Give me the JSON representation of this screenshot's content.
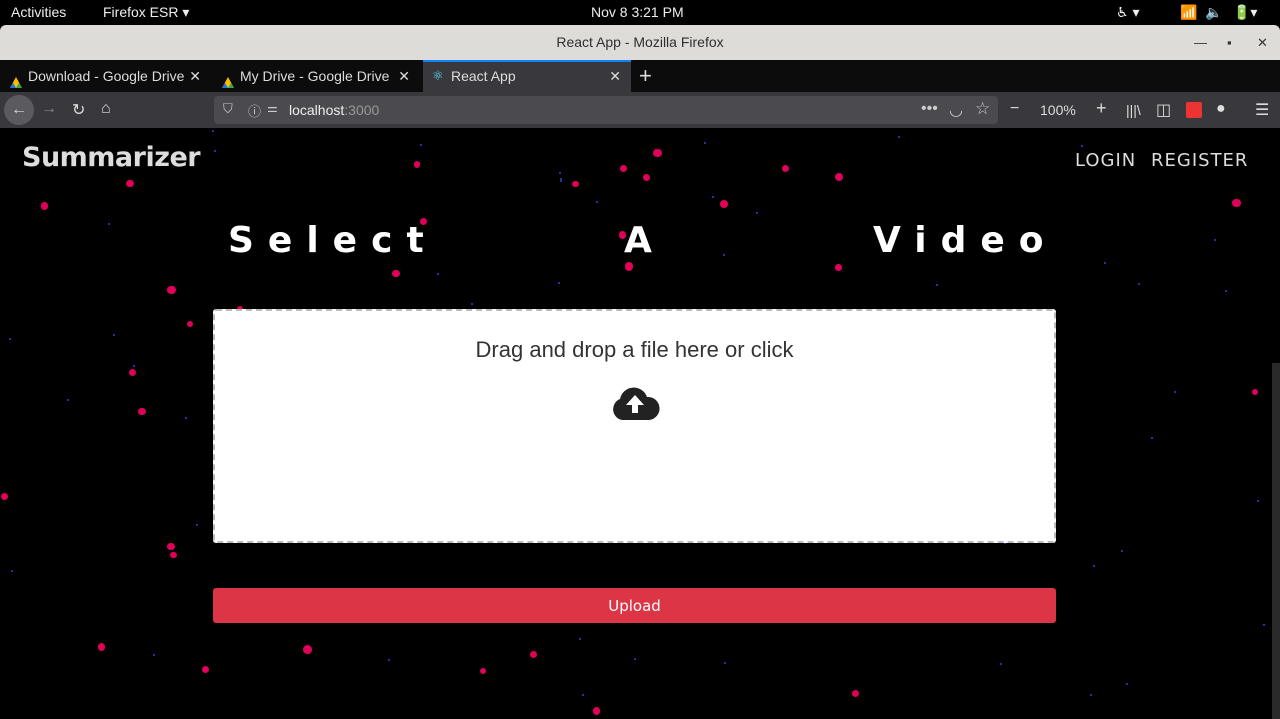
{
  "system": {
    "activities": "Activities",
    "app_menu": "Firefox ESR ▾",
    "clock": "Nov 8  3:21 PM"
  },
  "window": {
    "title": "React App - Mozilla Firefox"
  },
  "tabs": [
    {
      "label": "Download - Google Drive"
    },
    {
      "label": "My Drive - Google Drive"
    },
    {
      "label": "React App",
      "active": true
    }
  ],
  "navbar": {
    "url_host": "localhost",
    "url_port": ":3000",
    "zoom": "100%"
  },
  "app": {
    "brand": "Summarizer",
    "nav": [
      {
        "label": "LOGIN"
      },
      {
        "label": "REGISTER"
      }
    ],
    "heading": [
      "Select",
      "A",
      "Video"
    ],
    "dropzone_label": "Drag and drop a file here or click",
    "upload_label": "Upload"
  },
  "colors": {
    "accent": "#dc3545",
    "dots": "#e0005a"
  }
}
